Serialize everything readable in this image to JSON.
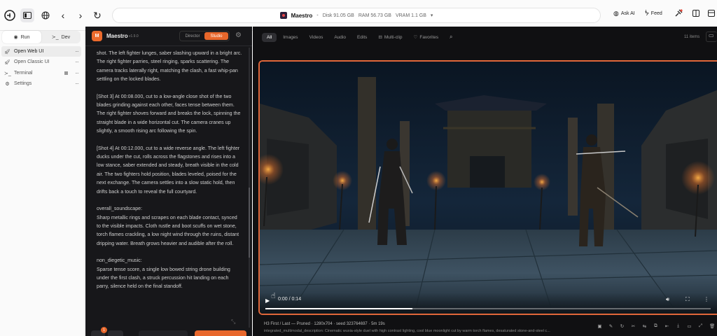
{
  "topbar": {
    "app_name": "Maestro",
    "disk": "Disk 91.05 GB",
    "ram": "RAM 56.73 GB",
    "vram": "VRAM 1.1 GB",
    "ask_ai": "Ask AI",
    "feed": "Feed"
  },
  "sidebar": {
    "run_label": "Run",
    "dev_label": "Dev",
    "items": [
      {
        "label": "Open Web UI"
      },
      {
        "label": "Open Classic UI"
      },
      {
        "label": "Terminal"
      },
      {
        "label": "Settings"
      }
    ]
  },
  "panel": {
    "logo": "M",
    "title": "Maestro",
    "version": "v1.9.0",
    "mode_director": "Director",
    "mode_studio": "Studio",
    "paragraphs": [
      "shot. The left fighter lunges, saber slashing upward in a bright arc. The right fighter parries, steel ringing, sparks scattering. The camera tracks laterally right, matching the clash, a fast whip-pan settling on the locked blades.",
      "[Shot 3] At 00:08.000, cut to a low-angle close shot of the two blades grinding against each other, faces tense between them. The right fighter shoves forward and breaks the lock, spinning the straight blade in a wide horizontal cut. The camera cranes up slightly, a smooth rising arc following the spin.",
      "[Shot 4] At 00:12.000, cut to a wide reverse angle. The left fighter ducks under the cut, rolls across the flagstones and rises into a low stance, saber extended and steady, breath visible in the cold air. The two fighters hold position, blades leveled, poised for the next exchange. The camera settles into a slow static hold, then drifts back a touch to reveal the full courtyard.",
      "overall_soundscape:\nSharp metallic rings and scrapes on each blade contact, synced to the visible impacts. Cloth rustle and boot scuffs on wet stone, torch flames crackling, a low night wind through the ruins, distant dripping water. Breath grows heavier and audible after the roll.",
      "non_diegetic_music:\nSparse tense score, a single low bowed string drone building under the first clash, a struck percussion hit landing on each parry, silence held on the final standoff."
    ],
    "badge": "1"
  },
  "gallery": {
    "tabs": [
      "All",
      "Images",
      "Videos",
      "Audio",
      "Edits",
      "Multi-clip",
      "Favorites"
    ],
    "count": "11 items",
    "player": {
      "time": "0:00 / 0:14",
      "progress": 0.33
    },
    "meta_title": "H3 First / Last — Pruned · 1280x704 · seed 323764697 · 5m 19s",
    "meta_desc": "integrated_multimodal_description: Cinematic wuxia-style duel with high contrast lighting, cool blue moonlight cut by warm torch flames, desaturated stone-and-steel c..."
  },
  "colors": {
    "accent": "#e8672b",
    "panel_bg": "#17171a",
    "gallery_bg": "#101012"
  }
}
